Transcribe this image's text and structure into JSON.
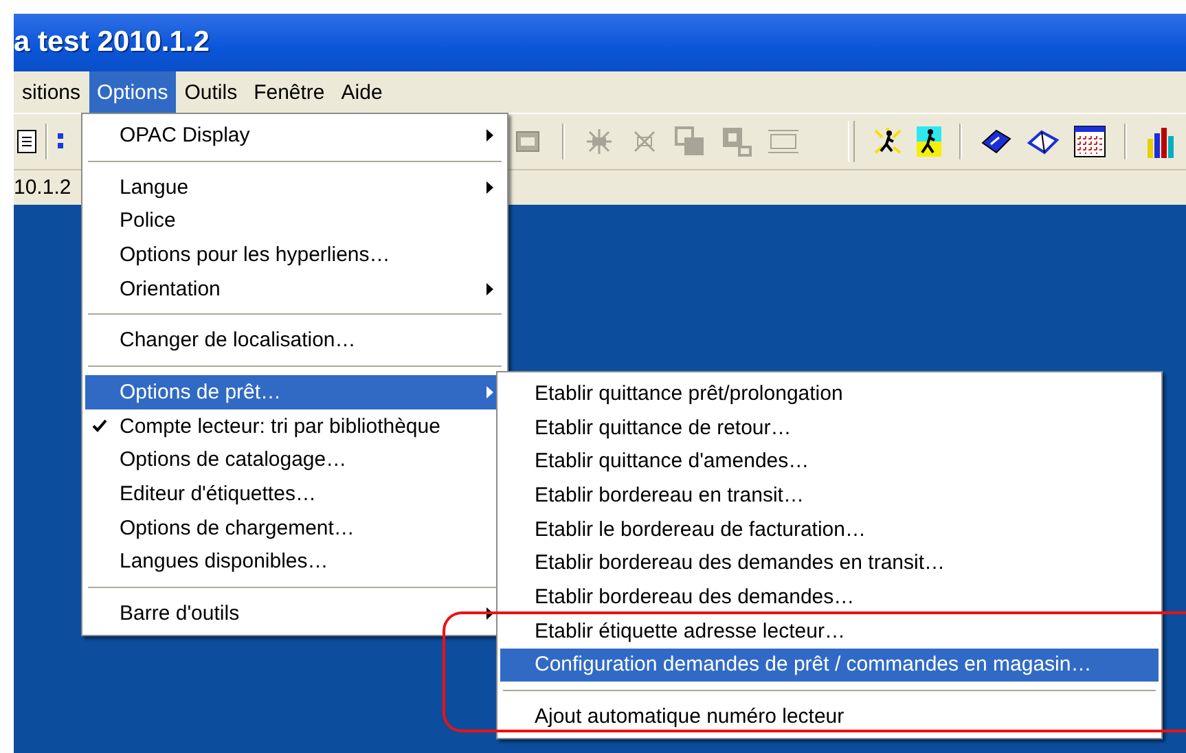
{
  "window": {
    "title": "a test 2010.1.2"
  },
  "menu_bar": [
    {
      "label": "sitions",
      "selected": false
    },
    {
      "label": "Options",
      "selected": true
    },
    {
      "label": "Outils",
      "selected": false
    },
    {
      "label": "Fenêtre",
      "selected": false
    },
    {
      "label": "Aide",
      "selected": false
    }
  ],
  "info_bar": {
    "text": "10.1.2"
  },
  "options_menu": [
    {
      "kind": "item",
      "label": "OPAC Display",
      "has_submenu": true,
      "checked": false,
      "selected": false
    },
    {
      "kind": "separator"
    },
    {
      "kind": "item",
      "label": "Langue",
      "has_submenu": true,
      "checked": false,
      "selected": false
    },
    {
      "kind": "item",
      "label": "Police",
      "has_submenu": false,
      "checked": false,
      "selected": false
    },
    {
      "kind": "item",
      "label": "Options pour les hyperliens…",
      "has_submenu": false,
      "checked": false,
      "selected": false
    },
    {
      "kind": "item",
      "label": "Orientation",
      "has_submenu": true,
      "checked": false,
      "selected": false
    },
    {
      "kind": "separator"
    },
    {
      "kind": "item",
      "label": "Changer de localisation…",
      "has_submenu": false,
      "checked": false,
      "selected": false
    },
    {
      "kind": "separator"
    },
    {
      "kind": "item",
      "label": "Options de prêt…",
      "has_submenu": true,
      "checked": false,
      "selected": true
    },
    {
      "kind": "item",
      "label": "Compte lecteur: tri par bibliothèque",
      "has_submenu": false,
      "checked": true,
      "selected": false
    },
    {
      "kind": "item",
      "label": "Options de catalogage…",
      "has_submenu": false,
      "checked": false,
      "selected": false
    },
    {
      "kind": "item",
      "label": "Editeur d'étiquettes…",
      "has_submenu": false,
      "checked": false,
      "selected": false
    },
    {
      "kind": "item",
      "label": "Options de chargement…",
      "has_submenu": false,
      "checked": false,
      "selected": false
    },
    {
      "kind": "item",
      "label": "Langues disponibles…",
      "has_submenu": false,
      "checked": false,
      "selected": false
    },
    {
      "kind": "separator"
    },
    {
      "kind": "item",
      "label": "Barre d'outils",
      "has_submenu": true,
      "checked": false,
      "selected": false
    }
  ],
  "loan_submenu": [
    {
      "kind": "item",
      "label": "Etablir quittance prêt/prolongation",
      "selected": false
    },
    {
      "kind": "item",
      "label": "Etablir quittance de retour…",
      "selected": false
    },
    {
      "kind": "item",
      "label": "Etablir quittance d'amendes…",
      "selected": false
    },
    {
      "kind": "item",
      "label": "Etablir bordereau en transit…",
      "selected": false
    },
    {
      "kind": "item",
      "label": "Etablir le bordereau de facturation…",
      "selected": false
    },
    {
      "kind": "item",
      "label": "Etablir bordereau des demandes en transit…",
      "selected": false
    },
    {
      "kind": "item",
      "label": "Etablir bordereau des demandes…",
      "selected": false
    },
    {
      "kind": "item",
      "label": "Etablir étiquette adresse lecteur…",
      "selected": false
    },
    {
      "kind": "item",
      "label": "Configuration demandes de prêt / commandes en magasin…",
      "selected": true
    },
    {
      "kind": "separator"
    },
    {
      "kind": "item",
      "label": "Ajout automatique numéro lecteur",
      "selected": false
    }
  ]
}
